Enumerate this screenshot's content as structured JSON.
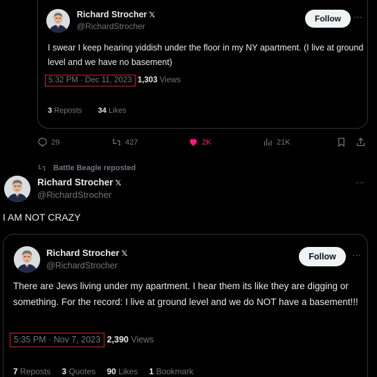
{
  "quoted_top": {
    "author_name": "Richard Strocher",
    "verified_mark": "𝕏",
    "handle": "@RichardStrocher",
    "follow_label": "Follow",
    "more_label": "···",
    "text": "I swear I keep hearing yiddish under the floor in my NY apartment. (I live at ground level and we have no basement)",
    "timestamp": "5:32 PM · Dec 11, 2023",
    "separator": "·",
    "views_count": "1,303",
    "views_label": "Views",
    "reposts_count": "3",
    "reposts_label": "Reposts",
    "likes_count": "34",
    "likes_label": "Likes"
  },
  "action_bar": {
    "replies": "29",
    "reposts": "427",
    "likes": "2K",
    "views": "21K",
    "icons": [
      "reply-icon",
      "repost-icon",
      "heart-icon",
      "views-icon",
      "bookmark-icon",
      "share-icon"
    ],
    "like_color": "#f91880"
  },
  "repost_notice": {
    "text": "Battle Beagle reposted"
  },
  "main_tweet": {
    "author_name": "Richard Strocher",
    "verified_mark": "𝕏",
    "handle": "@RichardStrocher",
    "more_label": "···",
    "text": "I AM NOT CRAZY"
  },
  "quoted_bottom": {
    "author_name": "Richard Strocher",
    "verified_mark": "𝕏",
    "handle": "@RichardStrocher",
    "follow_label": "Follow",
    "more_label": "···",
    "text": "There are Jews living under my apartment. I hear them its like they are digging or something. For the record: I live at ground level and we do NOT have a basement!!!",
    "timestamp": "5:35 PM · Nov 7, 2023",
    "views_count": "2,390",
    "views_label": "Views",
    "reposts_count": "7",
    "reposts_label": "Reposts",
    "quotes_count": "3",
    "quotes_label": "Quotes",
    "likes_count": "90",
    "likes_label": "Likes",
    "bookmarks_count": "1",
    "bookmarks_label": "Bookmark"
  },
  "colors": {
    "background": "#000000",
    "text": "#e7e9ea",
    "muted": "#71767b",
    "border": "#2f3336",
    "highlight_box": "#d4242c",
    "follow_bg": "#eff3f4"
  }
}
